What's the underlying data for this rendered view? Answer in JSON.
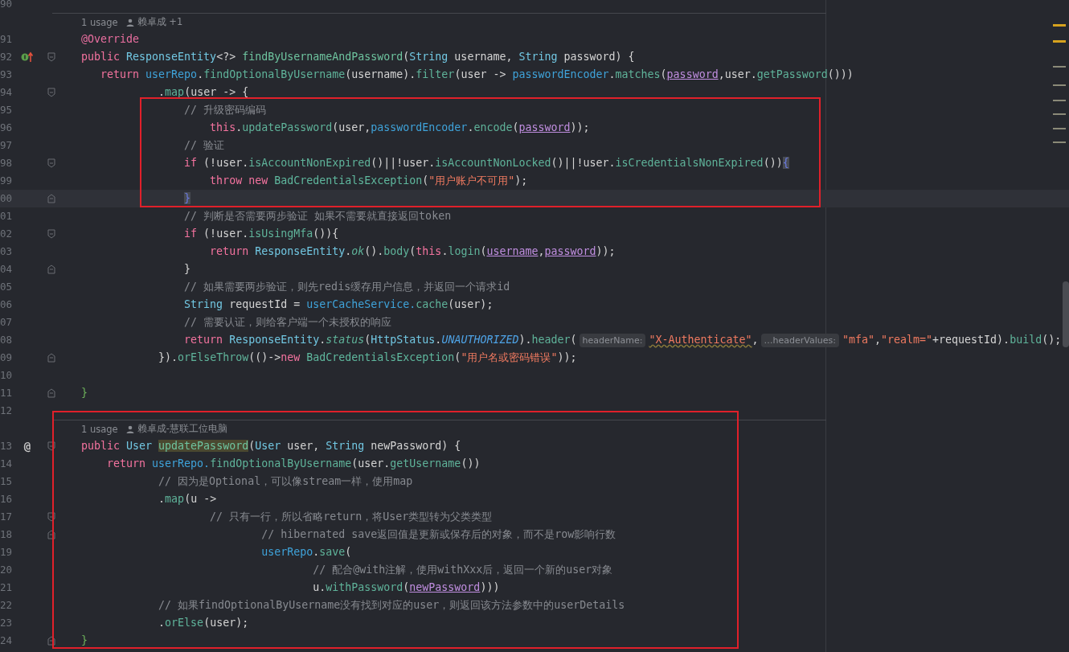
{
  "sections": [
    {
      "rows": [
        {
          "kind": "line",
          "number": "90",
          "current": false
        },
        {
          "kind": "usage",
          "usages": "1 usage",
          "author": "赖卓成 +1"
        },
        {
          "kind": "line",
          "number": "91",
          "current": false,
          "tokens": [
            {
              "kind": "ann",
              "text": "@Override"
            }
          ]
        },
        {
          "kind": "line",
          "number": "92",
          "current": false,
          "gutter": {
            "kind": "implements"
          },
          "fold": {
            "kind": "open"
          },
          "tokens": [
            {
              "kind": "kw",
              "text": "public "
            },
            {
              "kind": "type",
              "text": "ResponseEntity"
            },
            {
              "kind": "txt",
              "text": "<?> "
            },
            {
              "kind": "decl",
              "text": "findByUsernameAndPassword"
            },
            {
              "kind": "txt",
              "text": "("
            },
            {
              "kind": "type",
              "text": "String"
            },
            {
              "kind": "txt",
              "text": " username, "
            },
            {
              "kind": "type",
              "text": "String"
            },
            {
              "kind": "txt",
              "text": " password) {"
            }
          ]
        },
        {
          "kind": "line",
          "number": "93",
          "current": false,
          "tokens": [
            {
              "kind": "kw",
              "text": "   return "
            },
            {
              "kind": "field",
              "text": "userRepo"
            },
            {
              "kind": "txt",
              "text": "."
            },
            {
              "kind": "call",
              "text": "findOptionalByUsername"
            },
            {
              "kind": "txt",
              "text": "(username)."
            },
            {
              "kind": "call",
              "text": "filter"
            },
            {
              "kind": "txt",
              "text": "(user -> "
            },
            {
              "kind": "field",
              "text": "passwordEncoder"
            },
            {
              "kind": "txt",
              "text": "."
            },
            {
              "kind": "call",
              "text": "matches"
            },
            {
              "kind": "txt",
              "text": "("
            },
            {
              "kind": "param",
              "text": "password"
            },
            {
              "kind": "txt",
              "text": ",user."
            },
            {
              "kind": "call",
              "text": "getPassword"
            },
            {
              "kind": "txt",
              "text": "()))"
            }
          ]
        },
        {
          "kind": "line",
          "number": "94",
          "current": false,
          "fold": {
            "kind": "open"
          },
          "tokens": [
            {
              "kind": "txt",
              "text": "            ."
            },
            {
              "kind": "call",
              "text": "map"
            },
            {
              "kind": "txt",
              "text": "(user -> {"
            }
          ]
        }
      ]
    },
    {
      "frame": {
        "kind": "code"
      },
      "rows": [
        {
          "kind": "line",
          "number": "95",
          "current": false,
          "tokens": [
            {
              "kind": "cmt",
              "text": "                // 升级密码编码"
            }
          ]
        },
        {
          "kind": "line",
          "number": "96",
          "current": false,
          "tokens": [
            {
              "kind": "kw",
              "text": "                    this"
            },
            {
              "kind": "txt",
              "text": "."
            },
            {
              "kind": "call",
              "text": "updatePassword"
            },
            {
              "kind": "txt",
              "text": "(user,"
            },
            {
              "kind": "field",
              "text": "passwordEncoder"
            },
            {
              "kind": "txt",
              "text": "."
            },
            {
              "kind": "call",
              "text": "encode"
            },
            {
              "kind": "txt",
              "text": "("
            },
            {
              "kind": "param",
              "text": "password"
            },
            {
              "kind": "txt",
              "text": "));"
            }
          ]
        },
        {
          "kind": "line",
          "number": "97",
          "current": false,
          "tokens": [
            {
              "kind": "cmt",
              "text": "                // 验证"
            }
          ]
        },
        {
          "kind": "line",
          "number": "98",
          "current": false,
          "fold": {
            "kind": "open"
          },
          "tokens": [
            {
              "kind": "kw",
              "text": "                if"
            },
            {
              "kind": "txt",
              "text": " (!user."
            },
            {
              "kind": "call",
              "text": "isAccountNonExpired"
            },
            {
              "kind": "txt",
              "text": "()||!user."
            },
            {
              "kind": "call",
              "text": "isAccountNonLocked"
            },
            {
              "kind": "txt",
              "text": "()||!user."
            },
            {
              "kind": "call",
              "text": "isCredentialsNonExpired"
            },
            {
              "kind": "txt",
              "text": "())"
            },
            {
              "kind": "brace",
              "text": "{"
            }
          ]
        },
        {
          "kind": "line",
          "number": "99",
          "current": false,
          "tokens": [
            {
              "kind": "kw",
              "text": "                    throw new "
            },
            {
              "kind": "cls",
              "text": "BadCredentialsException"
            },
            {
              "kind": "txt",
              "text": "("
            },
            {
              "kind": "str",
              "text": "\"用户账户不可用\""
            },
            {
              "kind": "txt",
              "text": ");"
            }
          ]
        },
        {
          "kind": "line",
          "number": "00",
          "current": true,
          "fold": {
            "kind": "close"
          },
          "tokens": [
            {
              "kind": "brace",
              "text": "                }"
            }
          ]
        }
      ]
    },
    {
      "rows": [
        {
          "kind": "line",
          "number": "01",
          "current": false,
          "tokens": [
            {
              "kind": "cmt",
              "text": "                // 判断是否需要两步验证 如果不需要就直接返回token"
            }
          ]
        },
        {
          "kind": "line",
          "number": "02",
          "current": false,
          "fold": {
            "kind": "open"
          },
          "tokens": [
            {
              "kind": "kw",
              "text": "                if"
            },
            {
              "kind": "txt",
              "text": " (!user."
            },
            {
              "kind": "call",
              "text": "isUsingMfa"
            },
            {
              "kind": "txt",
              "text": "()){"
            }
          ]
        },
        {
          "kind": "line",
          "number": "03",
          "current": false,
          "tokens": [
            {
              "kind": "kw",
              "text": "                    return "
            },
            {
              "kind": "type",
              "text": "ResponseEntity"
            },
            {
              "kind": "txt",
              "text": "."
            },
            {
              "kind": "ital",
              "text": "ok"
            },
            {
              "kind": "txt",
              "text": "()."
            },
            {
              "kind": "call",
              "text": "body"
            },
            {
              "kind": "txt",
              "text": "("
            },
            {
              "kind": "kw",
              "text": "this"
            },
            {
              "kind": "txt",
              "text": "."
            },
            {
              "kind": "call",
              "text": "login"
            },
            {
              "kind": "txt",
              "text": "("
            },
            {
              "kind": "param",
              "text": "username"
            },
            {
              "kind": "txt",
              "text": ","
            },
            {
              "kind": "param",
              "text": "password"
            },
            {
              "kind": "txt",
              "text": "));"
            }
          ]
        },
        {
          "kind": "line",
          "number": "04",
          "current": false,
          "fold": {
            "kind": "close"
          },
          "tokens": [
            {
              "kind": "txt",
              "text": "                }"
            }
          ]
        },
        {
          "kind": "line",
          "number": "05",
          "current": false,
          "tokens": [
            {
              "kind": "cmt",
              "text": "                // 如果需要两步验证，则先redis缓存用户信息，并返回一个请求id"
            }
          ]
        },
        {
          "kind": "line",
          "number": "06",
          "current": false,
          "tokens": [
            {
              "kind": "type",
              "text": "                String"
            },
            {
              "kind": "txt",
              "text": " requestId = "
            },
            {
              "kind": "field",
              "text": "userCacheService."
            },
            {
              "kind": "call",
              "text": "cache"
            },
            {
              "kind": "txt",
              "text": "(user);"
            }
          ]
        },
        {
          "kind": "line",
          "number": "07",
          "current": false,
          "tokens": [
            {
              "kind": "cmt",
              "text": "                // 需要认证，则给客户端一个未授权的响应"
            }
          ]
        },
        {
          "kind": "line",
          "number": "08",
          "current": false,
          "tokens": [
            {
              "kind": "kw",
              "text": "                return "
            },
            {
              "kind": "type",
              "text": "ResponseEntity"
            },
            {
              "kind": "txt",
              "text": "."
            },
            {
              "kind": "ital",
              "text": "status"
            },
            {
              "kind": "txt",
              "text": "("
            },
            {
              "kind": "type",
              "text": "HttpStatus"
            },
            {
              "kind": "txt",
              "text": "."
            },
            {
              "kind": "const",
              "text": "UNAUTHORIZED"
            },
            {
              "kind": "txt",
              "text": ")."
            },
            {
              "kind": "call",
              "text": "header"
            },
            {
              "kind": "txt",
              "text": "("
            },
            {
              "kind": "hint",
              "text": "headerName:"
            },
            {
              "kind": "strw",
              "text": "\"X-Authenticate\""
            },
            {
              "kind": "txt",
              "text": ","
            },
            {
              "kind": "hint",
              "text": "…headerValues:"
            },
            {
              "kind": "str",
              "text": "\"mfa\""
            },
            {
              "kind": "txt",
              "text": ","
            },
            {
              "kind": "str",
              "text": "\"realm=\""
            },
            {
              "kind": "txt",
              "text": "+requestId)."
            },
            {
              "kind": "call",
              "text": "build"
            },
            {
              "kind": "txt",
              "text": "();"
            }
          ]
        },
        {
          "kind": "line",
          "number": "09",
          "current": false,
          "fold": {
            "kind": "close"
          },
          "tokens": [
            {
              "kind": "txt",
              "text": "            })."
            },
            {
              "kind": "call",
              "text": "orElseThrow"
            },
            {
              "kind": "txt",
              "text": "(()->"
            },
            {
              "kind": "kw",
              "text": "new "
            },
            {
              "kind": "cls",
              "text": "BadCredentialsException"
            },
            {
              "kind": "txt",
              "text": "("
            },
            {
              "kind": "str",
              "text": "\"用户名或密码错误\""
            },
            {
              "kind": "txt",
              "text": "));"
            }
          ]
        },
        {
          "kind": "line",
          "number": "10",
          "current": false
        },
        {
          "kind": "line",
          "number": "11",
          "current": false,
          "fold": {
            "kind": "close"
          },
          "tokens": [
            {
              "kind": "green",
              "text": "}"
            }
          ]
        }
      ]
    },
    {
      "frame": {
        "kind": "method"
      },
      "rows": [
        {
          "kind": "line",
          "number": "12",
          "current": false
        },
        {
          "kind": "usage",
          "usages": "1 usage",
          "author": "赖卓成-慧联工位电脑"
        },
        {
          "kind": "line",
          "number": "13",
          "current": false,
          "gutter": {
            "kind": "at",
            "mark": "@"
          },
          "fold": {
            "kind": "open"
          },
          "tokens": [
            {
              "kind": "kw",
              "text": "public "
            },
            {
              "kind": "type",
              "text": "User "
            },
            {
              "kind": "hl",
              "text": "updatePassword"
            },
            {
              "kind": "txt",
              "text": "("
            },
            {
              "kind": "type",
              "text": "User"
            },
            {
              "kind": "txt",
              "text": " user, "
            },
            {
              "kind": "type",
              "text": "String"
            },
            {
              "kind": "txt",
              "text": " newPassword) {"
            }
          ]
        },
        {
          "kind": "line",
          "number": "14",
          "current": false,
          "tokens": [
            {
              "kind": "kw",
              "text": "    return "
            },
            {
              "kind": "field",
              "text": "userRepo."
            },
            {
              "kind": "call",
              "text": "findOptionalByUsername"
            },
            {
              "kind": "txt",
              "text": "(user."
            },
            {
              "kind": "call",
              "text": "getUsername"
            },
            {
              "kind": "txt",
              "text": "())"
            }
          ]
        },
        {
          "kind": "line",
          "number": "15",
          "current": false,
          "tokens": [
            {
              "kind": "cmt",
              "text": "            // 因为是Optional，可以像stream一样，使用map"
            }
          ]
        },
        {
          "kind": "line",
          "number": "16",
          "current": false,
          "tokens": [
            {
              "kind": "txt",
              "text": "            ."
            },
            {
              "kind": "call",
              "text": "map"
            },
            {
              "kind": "txt",
              "text": "(u ->"
            }
          ]
        },
        {
          "kind": "line",
          "number": "17",
          "current": false,
          "fold": {
            "kind": "open"
          },
          "tokens": [
            {
              "kind": "cmt",
              "text": "                    // 只有一行，所以省略return，将User类型转为父类类型"
            }
          ]
        },
        {
          "kind": "line",
          "number": "18",
          "current": false,
          "fold": {
            "kind": "close"
          },
          "tokens": [
            {
              "kind": "cmt",
              "text": "                            // hibernated save返回值是更新或保存后的对象，而不是row影响行数"
            }
          ]
        },
        {
          "kind": "line",
          "number": "19",
          "current": false,
          "tokens": [
            {
              "kind": "field",
              "text": "                            userRepo"
            },
            {
              "kind": "txt",
              "text": "."
            },
            {
              "kind": "call",
              "text": "save"
            },
            {
              "kind": "txt",
              "text": "("
            }
          ]
        },
        {
          "kind": "line",
          "number": "20",
          "current": false,
          "tokens": [
            {
              "kind": "cmt",
              "text": "                                    // 配合@with注解，使用withXxx后，返回一个新的user对象"
            }
          ]
        },
        {
          "kind": "line",
          "number": "21",
          "current": false,
          "tokens": [
            {
              "kind": "txt",
              "text": "                                    u."
            },
            {
              "kind": "call",
              "text": "withPassword"
            },
            {
              "kind": "txt",
              "text": "("
            },
            {
              "kind": "param",
              "text": "newPassword"
            },
            {
              "kind": "txt",
              "text": ")))"
            }
          ]
        },
        {
          "kind": "line",
          "number": "22",
          "current": false,
          "tokens": [
            {
              "kind": "cmt",
              "text": "            // 如果findOptionalByUsername没有找到对应的user，则返回该方法参数中的userDetails"
            }
          ]
        },
        {
          "kind": "line",
          "number": "23",
          "current": false,
          "tokens": [
            {
              "kind": "txt",
              "text": "            ."
            },
            {
              "kind": "call",
              "text": "orElse"
            },
            {
              "kind": "txt",
              "text": "(user);"
            }
          ]
        },
        {
          "kind": "line",
          "number": "24",
          "current": false,
          "fold": {
            "kind": "close"
          },
          "tokens": [
            {
              "kind": "green",
              "text": "}"
            }
          ]
        }
      ]
    }
  ]
}
